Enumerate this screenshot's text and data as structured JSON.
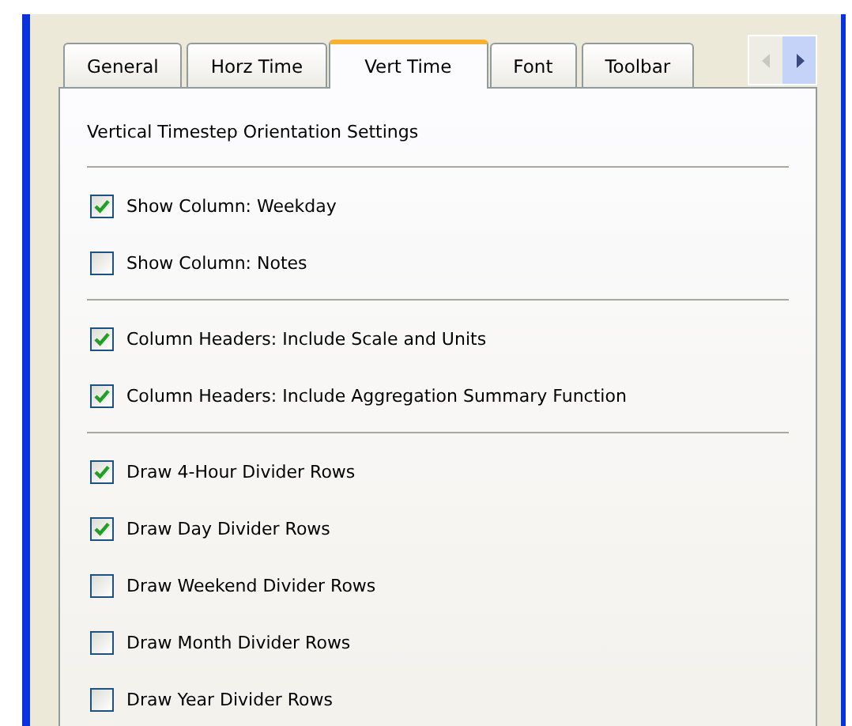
{
  "tabs": [
    {
      "label": "General",
      "selected": false
    },
    {
      "label": "Horz Time",
      "selected": false
    },
    {
      "label": "Vert Time",
      "selected": true
    },
    {
      "label": "Font",
      "selected": false
    },
    {
      "label": "Toolbar",
      "selected": false
    }
  ],
  "heading": "Vertical Timestep Orientation Settings",
  "groups": [
    {
      "options": [
        {
          "label": "Show Column: Weekday",
          "checked": true
        },
        {
          "label": "Show Column: Notes",
          "checked": false
        }
      ]
    },
    {
      "options": [
        {
          "label": "Column Headers: Include Scale and Units",
          "checked": true
        },
        {
          "label": "Column Headers: Include Aggregation Summary Function",
          "checked": true
        }
      ]
    },
    {
      "options": [
        {
          "label": "Draw 4-Hour Divider Rows",
          "checked": true
        },
        {
          "label": "Draw Day Divider Rows",
          "checked": true
        },
        {
          "label": "Draw Weekend Divider Rows",
          "checked": false
        },
        {
          "label": "Draw Month Divider Rows",
          "checked": false
        },
        {
          "label": "Draw Year Divider Rows",
          "checked": false
        }
      ]
    }
  ]
}
